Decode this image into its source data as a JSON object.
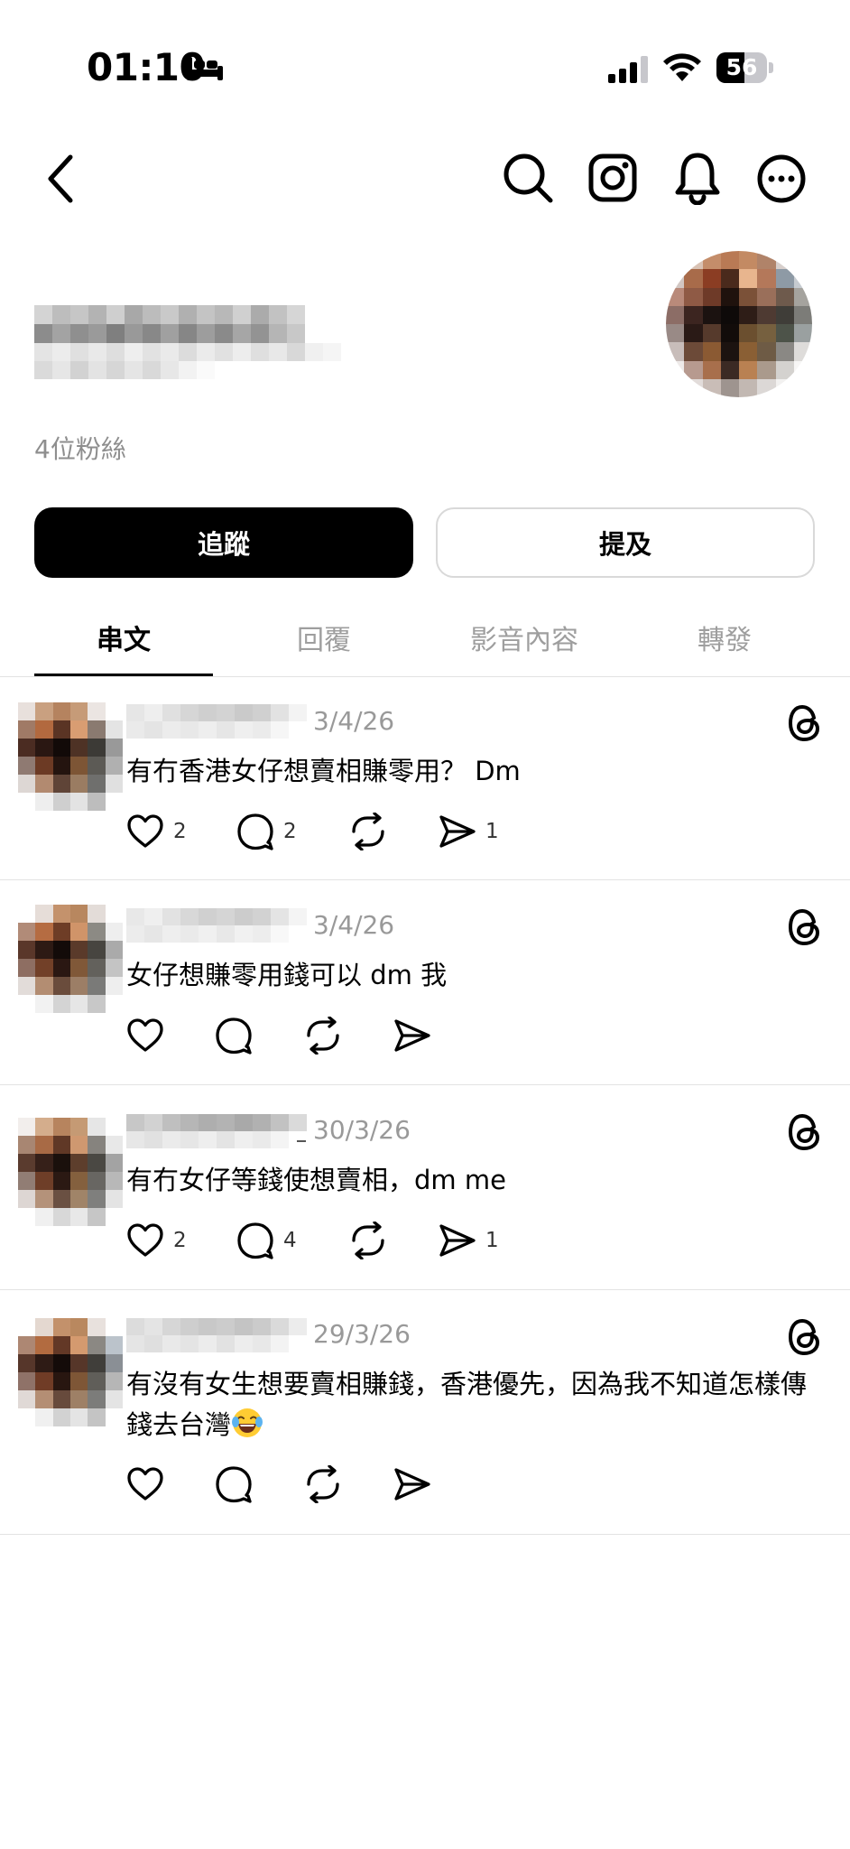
{
  "status_bar": {
    "time": "01:10",
    "battery_level": "56",
    "battery_fraction": 0.56
  },
  "profile": {
    "followers": "4位粉絲",
    "follow_label": "追蹤",
    "mention_label": "提及"
  },
  "tabs": [
    {
      "label": "串文",
      "active": true
    },
    {
      "label": "回覆",
      "active": false
    },
    {
      "label": "影音內容",
      "active": false
    },
    {
      "label": "轉發",
      "active": false
    }
  ],
  "posts": [
    {
      "date": "3/4/26",
      "text": "有冇香港女仔想賣相賺零用？  Dm",
      "likes": "2",
      "replies": "2",
      "reposts": "",
      "shares": "1"
    },
    {
      "date": "3/4/26",
      "text": "女仔想賺零用錢可以 dm 我",
      "likes": "",
      "replies": "",
      "reposts": "",
      "shares": ""
    },
    {
      "date": "30/3/26",
      "text": "有冇女仔等錢使想賣相，dm me",
      "likes": "2",
      "replies": "4",
      "reposts": "",
      "shares": "1"
    },
    {
      "date": "29/3/26",
      "text": "有沒有女生想要賣相賺錢，香港優先，因為我不知道怎樣傳錢去台灣",
      "likes": "",
      "replies": "",
      "reposts": "",
      "shares": ""
    }
  ],
  "icons": {
    "nav": [
      "back-icon",
      "search-icon",
      "instagram-icon",
      "bell-icon",
      "more-icon"
    ],
    "post_actions": [
      "heart-icon",
      "comment-icon",
      "repost-icon",
      "share-icon"
    ],
    "post_badge": "threads-icon",
    "emoji": "tears-of-joy-emoji"
  },
  "colors": {
    "primary_button": "#000000",
    "secondary_text": "#8e8e8e",
    "divider": "#e3e3e3"
  }
}
